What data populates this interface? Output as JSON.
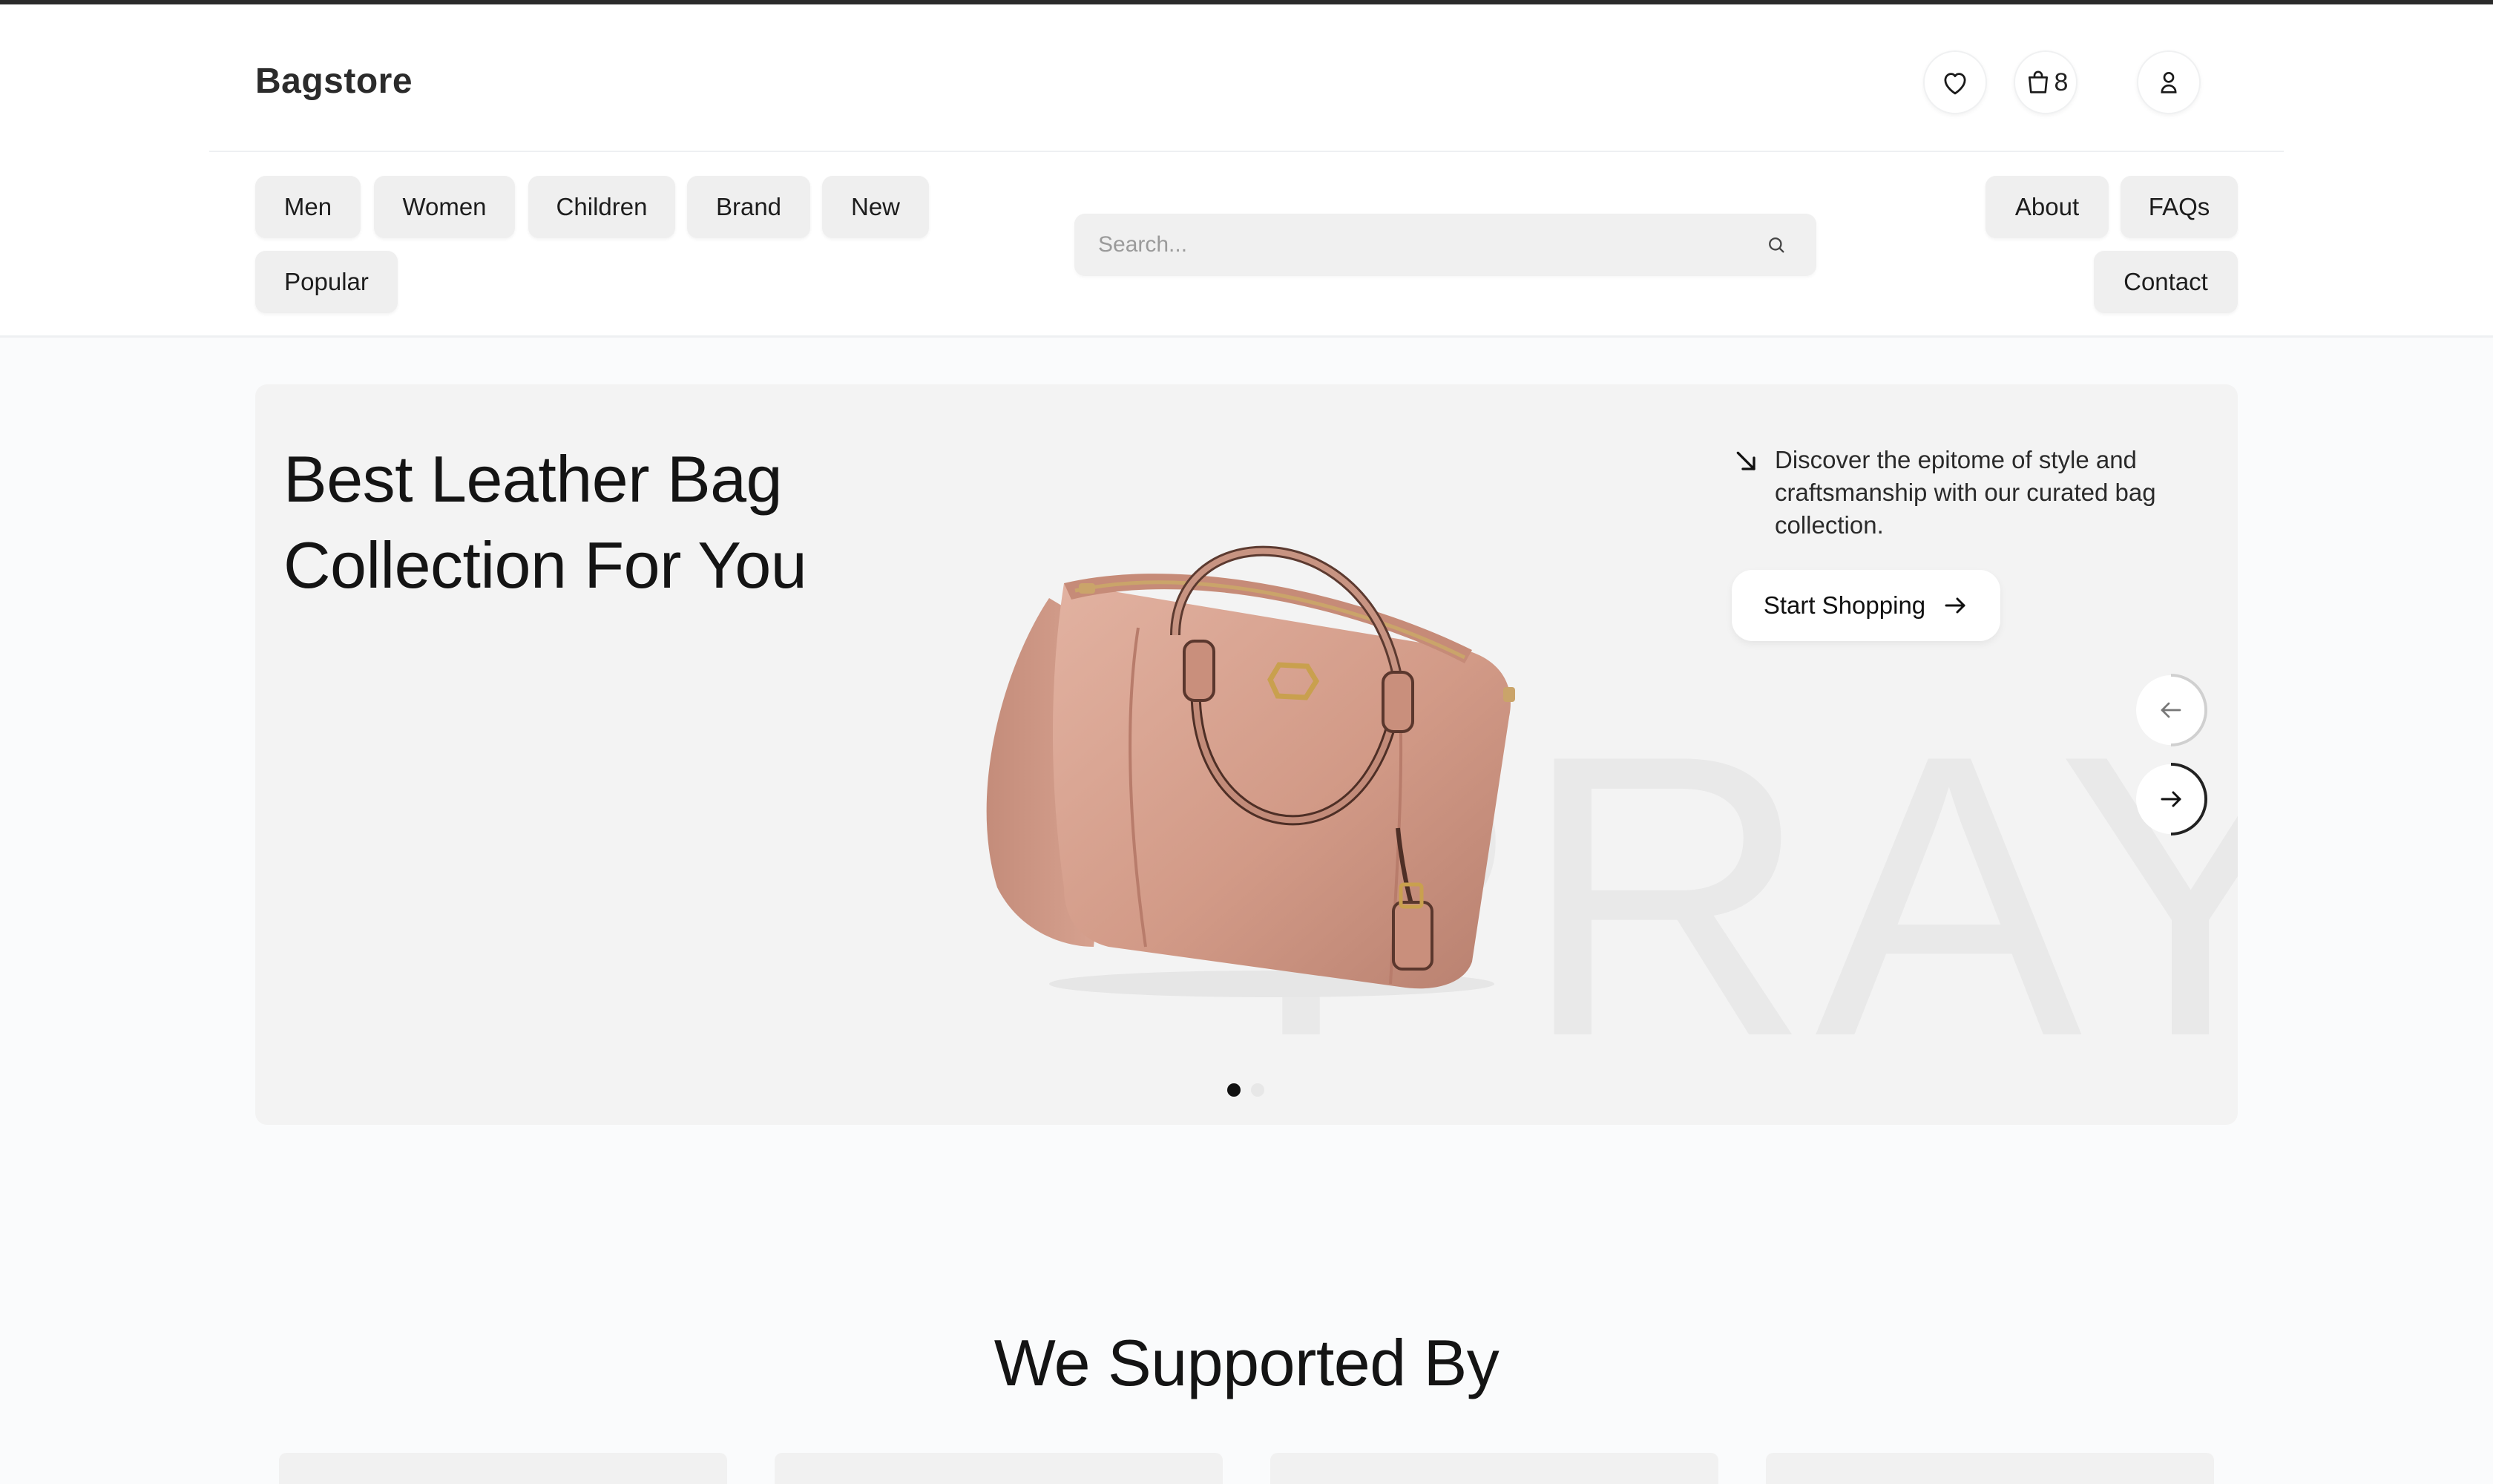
{
  "brand": {
    "name": "Bagstore"
  },
  "header": {
    "cart_count": "8",
    "nav_left": [
      "Men",
      "Women",
      "Children",
      "Brand",
      "New",
      "Popular"
    ],
    "nav_right": [
      "About",
      "FAQs",
      "Contact"
    ],
    "search": {
      "placeholder": "Search..."
    }
  },
  "hero": {
    "title_line1": "Best Leather Bag",
    "title_line2": "Collection For You",
    "watermark": "PRAYU",
    "description": "Discover the epitome of style and craftsmanship with our curated bag collection.",
    "cta_label": "Start Shopping",
    "slides_total": 2,
    "slide_active": 1
  },
  "supported": {
    "title": "We Supported By",
    "cards": 4
  },
  "colors": {
    "accent_dark": "#111111",
    "chip_bg": "#efefef",
    "hero_bg": "#f3f3f3",
    "bag": "#d8a190"
  },
  "icons": [
    "heart-icon",
    "shopping-bag-icon",
    "user-icon",
    "search-icon",
    "arrow-down-right-icon",
    "arrow-right-icon",
    "arrow-left-icon"
  ]
}
